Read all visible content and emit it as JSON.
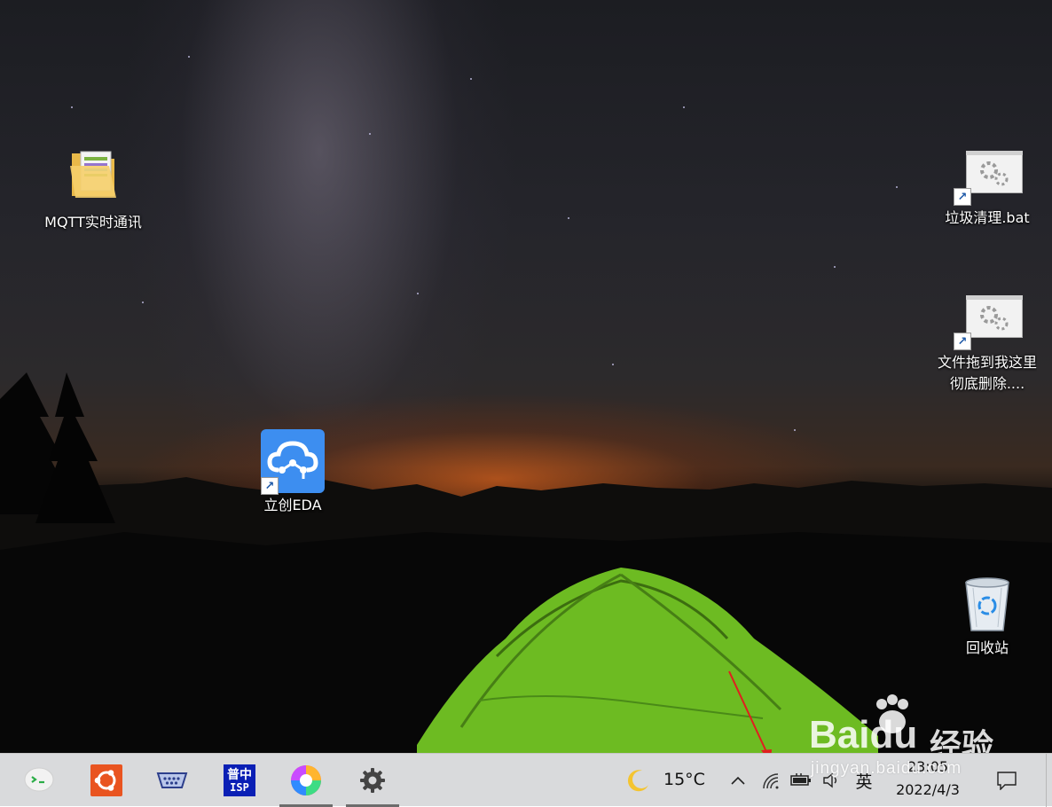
{
  "desktop": {
    "icons": [
      {
        "label": "MQTT实时通讯",
        "icon": "folder-icon"
      },
      {
        "label": "立创EDA",
        "icon": "cloud-eda-icon"
      },
      {
        "label": "垃圾清理.bat",
        "icon": "batch-file-icon"
      },
      {
        "label": "文件拖到我这里彻底删除....",
        "icon": "batch-file-icon"
      },
      {
        "label": "回收站",
        "icon": "recycle-bin-icon"
      }
    ]
  },
  "taskbar": {
    "apps": [
      {
        "name": "wechat-app",
        "icon": "wechat-icon"
      },
      {
        "name": "ubuntu-app",
        "icon": "ubuntu-icon"
      },
      {
        "name": "serial-port-app",
        "icon": "serial-port-icon"
      },
      {
        "name": "isp-app",
        "icon": "isp-icon",
        "text_top": "普中",
        "text_bottom": "ISP"
      },
      {
        "name": "photos-app",
        "icon": "pinwheel-icon"
      },
      {
        "name": "settings-app",
        "icon": "gear-icon"
      }
    ],
    "tray": {
      "weather_icon": "moon-icon",
      "temperature": "15°C",
      "overflow_icon": "chevron-up-icon",
      "wifi_icon": "wifi-icon",
      "battery_icon": "battery-icon",
      "volume_icon": "volume-icon",
      "input_method": "英",
      "time": "23:05",
      "date": "2022/4/3",
      "notification_icon": "notification-icon"
    }
  },
  "watermark": {
    "brand": "Baidu",
    "brand_suffix": "经验",
    "url": "jingyan.baidu.com"
  },
  "colors": {
    "taskbar_bg": "#d9dadc",
    "eda_blue": "#3d8ef0",
    "annotation_red": "#e01f1f",
    "tent_green": "#7fd12a"
  }
}
